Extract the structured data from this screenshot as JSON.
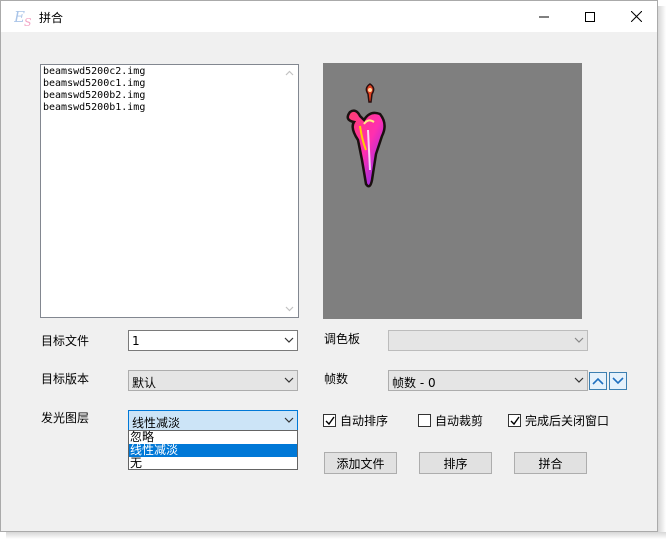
{
  "window": {
    "title": "拼合",
    "icon": "es-app-icon"
  },
  "file_list": {
    "items": [
      "beamswd5200c2.img",
      "beamswd5200c1.img",
      "beamswd5200b2.img",
      "beamswd5200b1.img"
    ]
  },
  "form": {
    "target_file": {
      "label": "目标文件",
      "value": "1"
    },
    "target_version": {
      "label": "目标版本",
      "value": "默认"
    },
    "glow_layer": {
      "label": "发光图层",
      "value": "线性减淡",
      "options": [
        "忽略",
        "线性减淡",
        "无"
      ],
      "selected_index": 1
    },
    "palette": {
      "label": "调色板",
      "value": ""
    },
    "frames": {
      "label": "帧数",
      "value": "帧数 - 0"
    }
  },
  "checkboxes": [
    {
      "label": "自动排序",
      "checked": true
    },
    {
      "label": "自动裁剪",
      "checked": false
    },
    {
      "label": "完成后关闭窗口",
      "checked": true
    }
  ],
  "buttons": {
    "add_file": "添加文件",
    "sort": "排序",
    "merge": "拼合"
  },
  "colors": {
    "preview_bg": "#7f7f7f",
    "selection": "#0078d7",
    "focus_bg": "#cce4f7"
  }
}
